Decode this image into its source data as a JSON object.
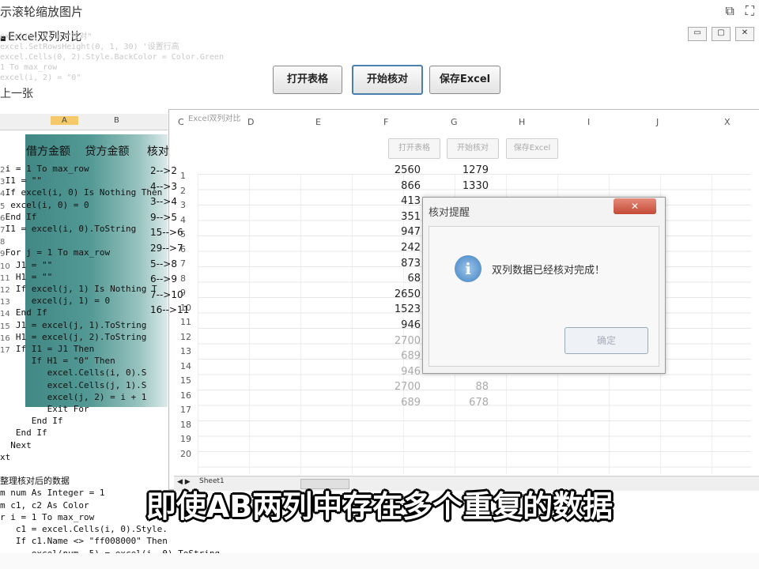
{
  "outer": {
    "title": "示滚轮缩放图片"
  },
  "window": {
    "title": "Excel双列对比",
    "min": "▭",
    "restore": "▢",
    "close": "✕"
  },
  "toolbar": {
    "open_label": "打开表格",
    "check_label": "开始核对",
    "save_label": "保存Excel"
  },
  "left": {
    "prev_label": "上一张",
    "faded_code": [
      "excel(0, 2) = \"核对\"",
      "excel.SetRowsHeight(0, 1, 30) '设置行高",
      "excel.Cells(0, 2).Style.BackColor = Color.Green",
      "",
      "   1  To max_row",
      "excel(i, 2) = \"0\""
    ],
    "columns": [
      "A",
      "B"
    ],
    "headers": [
      "借方金额",
      "贷方金额",
      "核对"
    ],
    "code": [
      " i = 1 To max_row",
      " I1 = \"\"",
      " If excel(i, 0) Is Nothing Then",
      "  excel(i, 0) = 0",
      " End If",
      " I1 = excel(i, 0).ToString",
      "",
      " For j = 1 To max_row",
      "   J1 = \"\"",
      "   H1 = \"\"",
      "   If excel(j, 1) Is Nothing T",
      "      excel(j, 1) = 0",
      "   End If",
      "   J1 = excel(j, 1).ToString",
      "   H1 = excel(j, 2).ToString",
      "   If I1 = J1 Then",
      "      If H1 = \"0\" Then",
      "         excel.Cells(i, 0).S",
      "         excel.Cells(j, 1).S",
      "         excel(j, 2) = i + 1",
      "         Exit For",
      "      End If",
      "   End If",
      "  Next",
      "xt",
      "",
      "整理核对后的数据",
      "m num As Integer = 1",
      "m c1, c2 As Color",
      "r i = 1 To max_row",
      "   c1 = excel.Cells(i, 0).Style.",
      "   If c1.Name <> \"ff008000\" Then",
      "      excel(num, 5) = excel(i, 0).ToString"
    ],
    "row_numbers": [
      "2",
      "3",
      "4",
      "5",
      "6",
      "7",
      "8",
      "9",
      "10",
      "11",
      "12",
      "13",
      "14",
      "15",
      "16",
      "17"
    ]
  },
  "grid": {
    "columns": [
      "C",
      "D",
      "E",
      "F",
      "G",
      "H",
      "I",
      "J",
      "X"
    ],
    "inner_title": "Excel双列对比",
    "ghost_buttons": [
      "打开表格",
      "开始核对",
      "保存Excel"
    ],
    "arrows": [
      "2-->2",
      "4-->3",
      "3-->4",
      "9-->5",
      "15-->6",
      "29-->7",
      "5-->8",
      "6-->9",
      "7-->10",
      "16-->11",
      "",
      "",
      "",
      "",
      "",
      ""
    ],
    "col_f": [
      "2560",
      "866",
      "413",
      "351",
      "947",
      "242",
      "873",
      "68",
      "2650",
      "1523",
      "946",
      "2700",
      "689",
      "946",
      "2700",
      "689"
    ],
    "col_g": [
      "1279",
      "1330",
      "",
      "",
      "",
      "",
      "",
      "",
      "",
      "",
      "",
      "",
      "",
      "",
      "88",
      "678"
    ],
    "row_labels": [
      "1",
      "2",
      "3",
      "4",
      "5",
      "6",
      "7",
      "8",
      "9",
      "10",
      "11",
      "12",
      "13",
      "14",
      "15",
      "16",
      "17",
      "18",
      "19",
      "20"
    ],
    "sheet": "Sheet1"
  },
  "dialog": {
    "title": "核对提醒",
    "message": "双列数据已经核对完成！",
    "ok": "确定",
    "close": "✕",
    "icon": "i"
  },
  "caption": "即使AB两列中存在多个重复的数据"
}
